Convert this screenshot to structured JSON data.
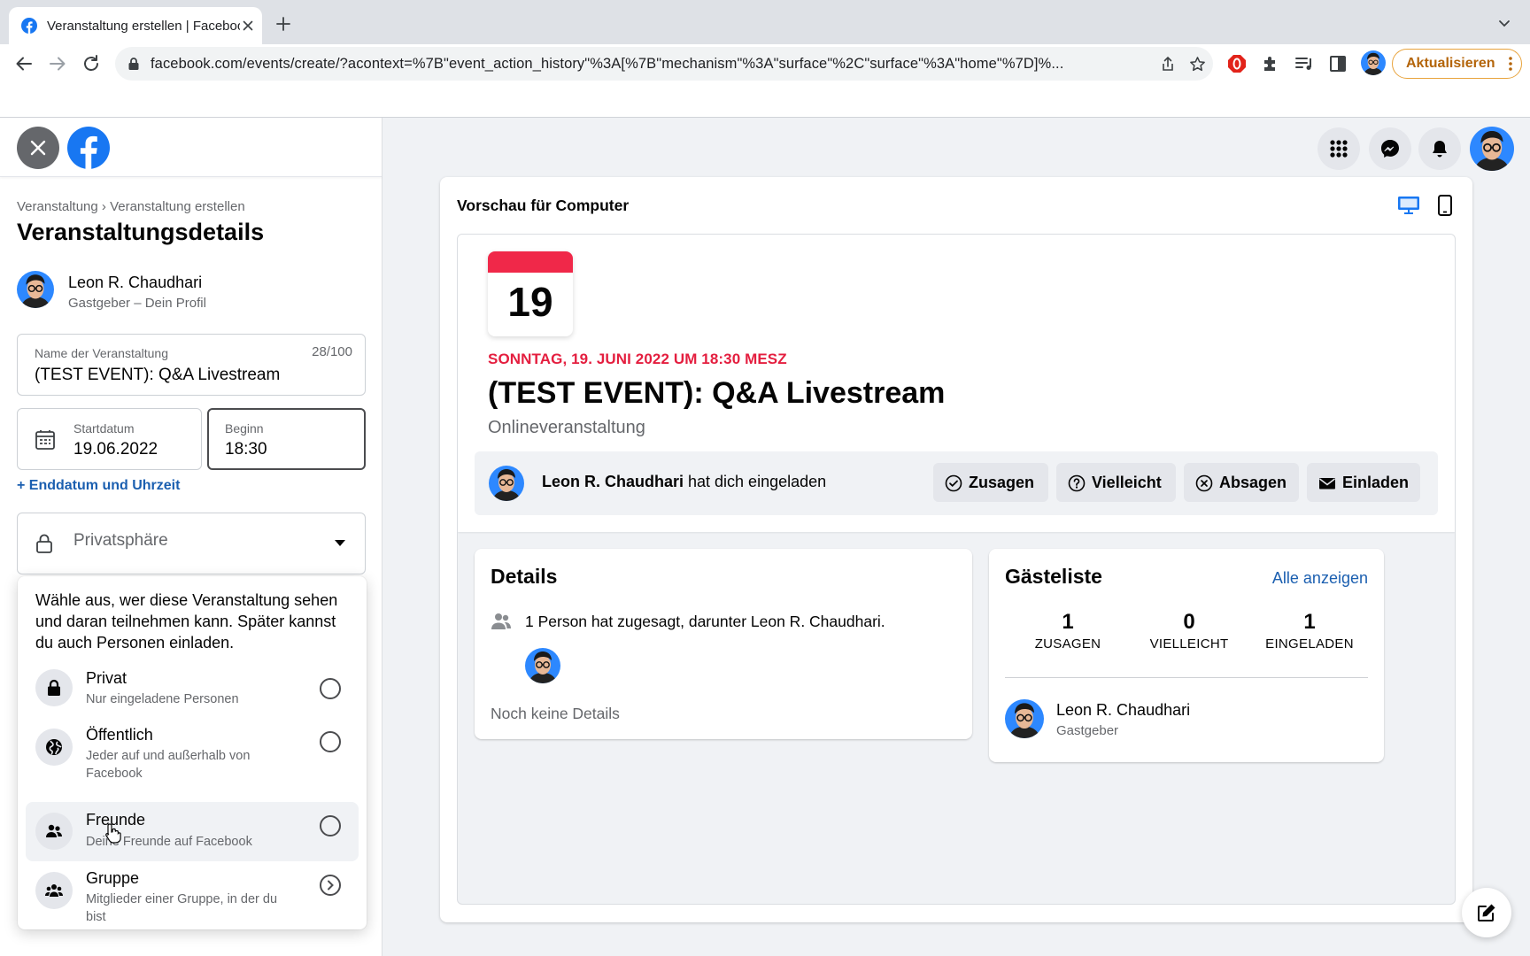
{
  "browser": {
    "tab_title": "Veranstaltung erstellen | Facebook",
    "url": "facebook.com/events/create/?acontext=%7B\"event_action_history\"%3A[%7B\"mechanism\"%3A\"surface\"%2C\"surface\"%3A\"home\"%7D]%...",
    "update_label": "Aktualisieren",
    "icons": [
      "facebook-favicon",
      "close-icon",
      "plus-icon",
      "chevron-down-icon",
      "back-arrow-icon",
      "forward-arrow-icon",
      "reload-icon",
      "lock-icon",
      "share-icon",
      "star-icon",
      "opera-extension-icon",
      "puzzle-icon",
      "media-icon",
      "sidepanel-icon",
      "profile-avatar",
      "more-vert-icon"
    ]
  },
  "left_panel": {
    "breadcrumb": "Veranstaltung › Veranstaltung erstellen",
    "title": "Veranstaltungsdetails",
    "host": {
      "name": "Leon R. Chaudhari",
      "subtitle": "Gastgeber – Dein Profil"
    },
    "event_name": {
      "label": "Name der Veranstaltung",
      "value": "(TEST EVENT): Q&A Livestream",
      "counter": "28/100"
    },
    "start_date": {
      "label": "Startdatum",
      "value": "19.06.2022"
    },
    "start_time": {
      "label": "Beginn",
      "value": "18:30"
    },
    "add_end": "+ Enddatum und Uhrzeit",
    "privacy": {
      "label": "Privatsphäre"
    },
    "privacy_dropdown": {
      "intro": "Wähle aus, wer diese Veranstaltung sehen und daran teilnehmen kann. Später kannst du auch Personen einladen.",
      "options": [
        {
          "title": "Privat",
          "subtitle": "Nur eingeladene Personen",
          "icon": "lock-icon"
        },
        {
          "title": "Öffentlich",
          "subtitle": "Jeder auf und außerhalb von Facebook",
          "icon": "globe-icon"
        },
        {
          "title": "Freunde",
          "subtitle": "Deine Freunde auf Facebook",
          "icon": "friends-icon"
        },
        {
          "title": "Gruppe",
          "subtitle": "Mitglieder einer Gruppe, in der du bist",
          "icon": "group-icon"
        }
      ]
    }
  },
  "preview": {
    "title": "Vorschau für Computer",
    "calendar_day": "19",
    "date_line": "SONNTAG, 19. JUNI 2022 UM 18:30 MESZ",
    "event_title": "(TEST EVENT): Q&A Livestream",
    "event_type": "Onlineveranstaltung",
    "invite": {
      "name": "Leon R. Chaudhari",
      "text": " hat dich eingeladen"
    },
    "actions": {
      "going": "Zusagen",
      "maybe": "Vielleicht",
      "decline": "Absagen",
      "invite": "Einladen"
    },
    "details": {
      "heading": "Details",
      "attendance": "1 Person hat zugesagt, darunter Leon R. Chaudhari.",
      "no_details": "Noch keine Details"
    },
    "guestlist": {
      "heading": "Gästeliste",
      "see_all": "Alle anzeigen",
      "stats": [
        {
          "count": "1",
          "label": "ZUSAGEN"
        },
        {
          "count": "0",
          "label": "VIELLEICHT"
        },
        {
          "count": "1",
          "label": "EINGELADEN"
        }
      ],
      "guest": {
        "name": "Leon R. Chaudhari",
        "role": "Gastgeber"
      }
    }
  },
  "colors": {
    "facebook_blue": "#1877f2",
    "link_blue": "#1b5fb0",
    "date_red": "#e41e3f",
    "calendar_red": "#f02849",
    "update_orange": "#e8a33c"
  }
}
